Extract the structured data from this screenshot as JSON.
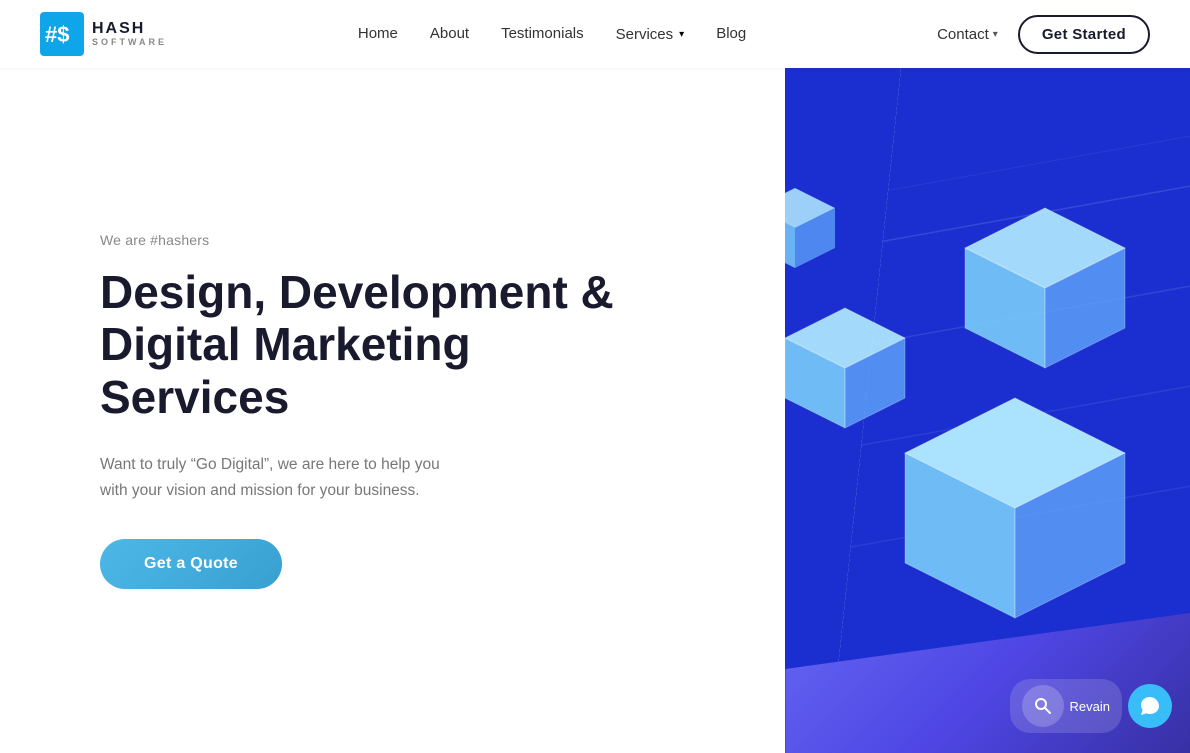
{
  "brand": {
    "name": "HASH",
    "tagline": "SOFTWARE",
    "logo_symbol": "#$"
  },
  "navbar": {
    "links": [
      {
        "id": "home",
        "label": "Home"
      },
      {
        "id": "about",
        "label": "About"
      },
      {
        "id": "testimonials",
        "label": "Testimonials"
      },
      {
        "id": "services",
        "label": "Services",
        "has_dropdown": true
      },
      {
        "id": "blog",
        "label": "Blog"
      }
    ],
    "contact_label": "Contact",
    "get_started_label": "Get Started"
  },
  "hero": {
    "subtitle": "We are #hashers",
    "title_line1": "Design, Development &",
    "title_line2": "Digital Marketing",
    "title_line3": "Services",
    "description": "Want to truly “Go Digital”, we are here to help you with your vision and mission for your business.",
    "cta_label": "Get a Quote"
  },
  "chat": {
    "icon": "💬",
    "label": "Revain"
  },
  "colors": {
    "hero_bg_right": "#1b2fd0",
    "cube_light": "#b3ecff",
    "cube_mid": "#7dd3fc",
    "cube_dark": "#3b82f6",
    "accent_blue": "#38bdf8"
  }
}
